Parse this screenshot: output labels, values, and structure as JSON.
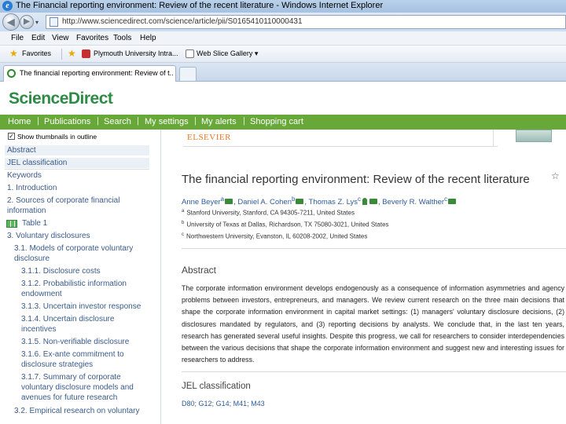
{
  "browser": {
    "window_title": "The Financial reporting environment: Review of the recent literature - Windows Internet Explorer",
    "url": "http://www.sciencedirect.com/science/article/pii/S0165410110000431",
    "menu": [
      "File",
      "Edit",
      "View",
      "Favorites",
      "Tools",
      "Help"
    ],
    "favorites": {
      "label": "Favorites",
      "links": [
        "Plymouth University Intra...",
        "Web Slice Gallery ▾"
      ]
    },
    "tab_title": "The financial reporting environment: Review of t..."
  },
  "site": {
    "logo": "ScienceDirect",
    "nav": [
      "Home",
      "Publications",
      "Search",
      "My settings",
      "My alerts",
      "Shopping cart"
    ]
  },
  "outline": {
    "thumbnail_option": "Show thumbnails in outline",
    "items": [
      {
        "label": "Abstract"
      },
      {
        "label": "JEL classification"
      },
      {
        "label": "Keywords"
      },
      {
        "label": "1. Introduction"
      },
      {
        "label": "2. Sources of corporate financial"
      },
      {
        "label": "information"
      },
      {
        "label": "Table 1"
      },
      {
        "label": "3. Voluntary disclosures"
      },
      {
        "label": "3.1. Models of corporate voluntary"
      },
      {
        "label": "disclosure"
      },
      {
        "label": "3.1.1. Disclosure costs"
      },
      {
        "label": "3.1.2. Probabilistic information"
      },
      {
        "label": "endowment"
      },
      {
        "label": "3.1.3. Uncertain investor response"
      },
      {
        "label": "3.1.4. Uncertain disclosure"
      },
      {
        "label": "incentives"
      },
      {
        "label": "3.1.5. Non-verifiable disclosure"
      },
      {
        "label": "3.1.6. Ex-ante commitment to"
      },
      {
        "label": "disclosure strategies"
      },
      {
        "label": "3.1.7. Summary of corporate"
      },
      {
        "label": "voluntary disclosure models and"
      },
      {
        "label": "avenues for future research"
      },
      {
        "label": "3.2. Empirical research on voluntary"
      }
    ]
  },
  "article": {
    "publisher": "ELSEVIER",
    "title": "The financial reporting environment: Review of the recent literature",
    "title_star": "☆",
    "authors": [
      {
        "name": "Anne Beyer",
        "sup": "a"
      },
      {
        "name": "Daniel A. Cohen",
        "sup": "b"
      },
      {
        "name": "Thomas Z. Lys",
        "sup": "c"
      },
      {
        "name": "Beverly R. Walther",
        "sup": "c"
      }
    ],
    "affiliations": [
      {
        "sup": "a",
        "text": "Stanford University, Stanford, CA 94305-7211, United States"
      },
      {
        "sup": "b",
        "text": "University of Texas at Dallas, Richardson, TX 75080-3021, United States"
      },
      {
        "sup": "c",
        "text": "Northwestern University, Evanston, IL 60208-2002, United States"
      }
    ],
    "abstract_heading": "Abstract",
    "abstract": "The corporate information environment develops endogenously as a consequence of information asymmetries and agency problems between investors, entrepreneurs, and managers. We review current research on the three main decisions that shape the corporate information environment in capital market settings: (1) managers' voluntary disclosure decisions, (2) disclosures mandated by regulators, and (3) reporting decisions by analysts. We conclude that, in the last ten years, research has generated several useful insights. Despite this progress, we call for researchers to consider interdependencies between the various decisions that shape the corporate information environment and suggest new and interesting issues for researchers to address.",
    "jel_heading": "JEL classification",
    "jel_codes": [
      "D80",
      "G12",
      "G14",
      "M41",
      "M43"
    ]
  }
}
